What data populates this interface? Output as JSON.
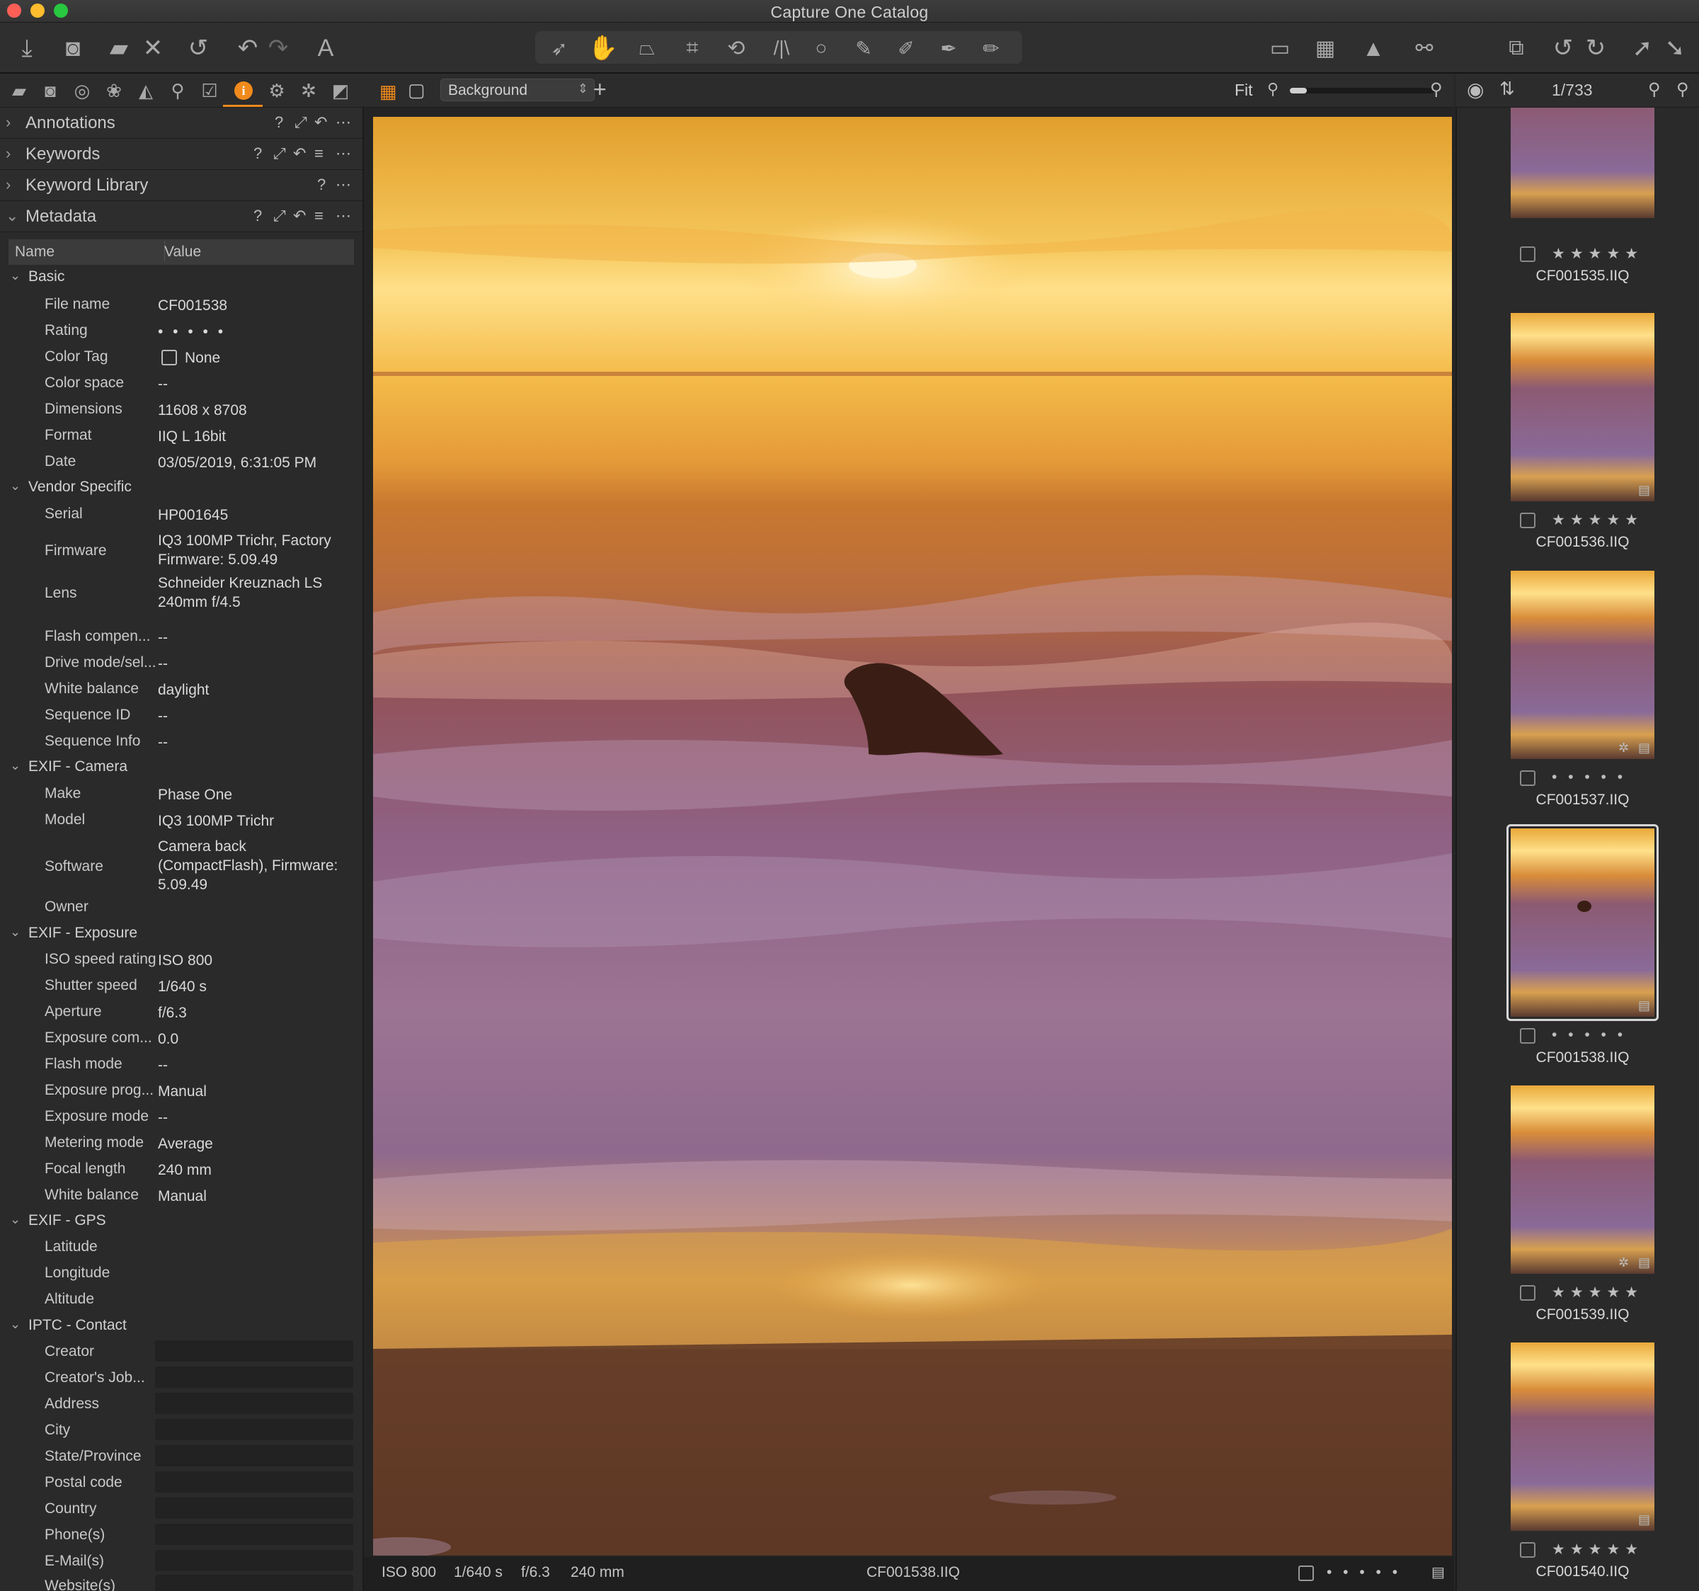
{
  "app": {
    "title": "Capture One Catalog"
  },
  "toolbar": {
    "left_icons": [
      "import-icon",
      "camera-icon",
      "move-to-folder-icon",
      "delete-icon",
      "reset-icon",
      "undo-icon",
      "redo-icon",
      "text-tool-icon"
    ],
    "cursor_tools": [
      "select-cursor-icon",
      "pan-hand-icon",
      "perspective-icon",
      "crop-icon",
      "rotate-icon",
      "keystone-icon",
      "spot-removal-icon",
      "draw-mask-icon",
      "linear-gradient-icon",
      "radial-mask-icon",
      "erase-mask-icon"
    ],
    "right_icons": [
      "edit-overlay-icon",
      "grid-icon",
      "exposure-warning-icon",
      "proof-glasses-icon",
      "viewer-mode-icon",
      "rotate-left-icon",
      "rotate-right-icon",
      "expand-icon",
      "collapse-icon"
    ]
  },
  "tool_tabs": [
    "library-icon",
    "capture-icon",
    "lens-icon",
    "color-icon",
    "exposure-icon",
    "details-icon",
    "adjustments-icon",
    "metadata-icon",
    "output-icon",
    "batch-icon",
    "styles-icon"
  ],
  "panels": {
    "annotations": "Annotations",
    "keywords": "Keywords",
    "keyword_library": "Keyword Library",
    "metadata": "Metadata"
  },
  "metadata": {
    "col_name": "Name",
    "col_value": "Value",
    "basic": {
      "title": "Basic",
      "file_name_label": "File name",
      "file_name": "CF001538",
      "rating_label": "Rating",
      "rating_value": "• • • • •",
      "color_tag_label": "Color Tag",
      "color_tag": "None",
      "color_space_label": "Color space",
      "color_space": "--",
      "dimensions_label": "Dimensions",
      "dimensions": "11608 x 8708",
      "format_label": "Format",
      "format": "IIQ L 16bit",
      "date_label": "Date",
      "date": "03/05/2019, 6:31:05 PM"
    },
    "vendor": {
      "title": "Vendor Specific",
      "serial_label": "Serial",
      "serial": "HP001645",
      "firmware_label": "Firmware",
      "firmware_1": "IQ3 100MP Trichr, Factory",
      "firmware_2": "Firmware: 5.09.49",
      "lens_label": "Lens",
      "lens_1": "Schneider Kreuznach LS",
      "lens_2": "240mm f/4.5",
      "flash_comp_label": "Flash compen...",
      "flash_comp": "--",
      "drive_label": "Drive mode/sel...",
      "drive": "--",
      "wb_label": "White balance",
      "wb": "daylight",
      "seq_id_label": "Sequence ID",
      "seq_id": "--",
      "seq_info_label": "Sequence Info",
      "seq_info": "--"
    },
    "exif_camera": {
      "title": "EXIF - Camera",
      "make_label": "Make",
      "make": "Phase One",
      "model_label": "Model",
      "model": "IQ3 100MP Trichr",
      "software_label": "Software",
      "software_1": "Camera back",
      "software_2": "(CompactFlash), Firmware:",
      "software_3": "5.09.49",
      "owner_label": "Owner"
    },
    "exif_exposure": {
      "title": "EXIF - Exposure",
      "iso_label": "ISO speed rating",
      "iso": "ISO 800",
      "shutter_label": "Shutter speed",
      "shutter": "1/640 s",
      "aperture_label": "Aperture",
      "aperture": "f/6.3",
      "exp_comp_label": "Exposure com...",
      "exp_comp": "0.0",
      "flash_label": "Flash mode",
      "flash": "--",
      "program_label": "Exposure prog...",
      "program": "Manual",
      "mode_label": "Exposure mode",
      "mode": "--",
      "metering_label": "Metering mode",
      "metering": "Average",
      "focal_label": "Focal length",
      "focal": "240 mm",
      "wb_label": "White balance",
      "wb": "Manual"
    },
    "exif_gps": {
      "title": "EXIF - GPS",
      "latitude_label": "Latitude",
      "longitude_label": "Longitude",
      "altitude_label": "Altitude"
    },
    "iptc_contact": {
      "title": "IPTC - Contact",
      "creator": "Creator",
      "job": "Creator's Job...",
      "address": "Address",
      "city": "City",
      "state": "State/Province",
      "postal": "Postal code",
      "country": "Country",
      "phone": "Phone(s)",
      "email": "E-Mail(s)",
      "website": "Website(s)"
    }
  },
  "viewer": {
    "layer_select": "Background",
    "zoom_label": "Fit",
    "zoom_level": 0.12
  },
  "status": {
    "iso": "ISO 800",
    "shutter": "1/640 s",
    "aperture": "f/6.3",
    "focal": "240 mm",
    "filename": "CF001538.IIQ",
    "rating": "• • • • •"
  },
  "browser": {
    "counter": "1/733",
    "thumbs": [
      {
        "name": "CF001535.IIQ",
        "stars": "★★★★★"
      },
      {
        "name": "CF001536.IIQ",
        "stars": "★★★★★"
      },
      {
        "name": "CF001537.IIQ",
        "stars": "• • • • •"
      },
      {
        "name": "CF001538.IIQ",
        "stars": "• • • • •"
      },
      {
        "name": "CF001539.IIQ",
        "stars": "★★★★★"
      },
      {
        "name": "CF001540.IIQ",
        "stars": "★★★★★"
      }
    ]
  },
  "colors": {
    "accent": "#f08a1c",
    "panel": "#2a2a2a",
    "toolbar": "#2f2f2f"
  }
}
